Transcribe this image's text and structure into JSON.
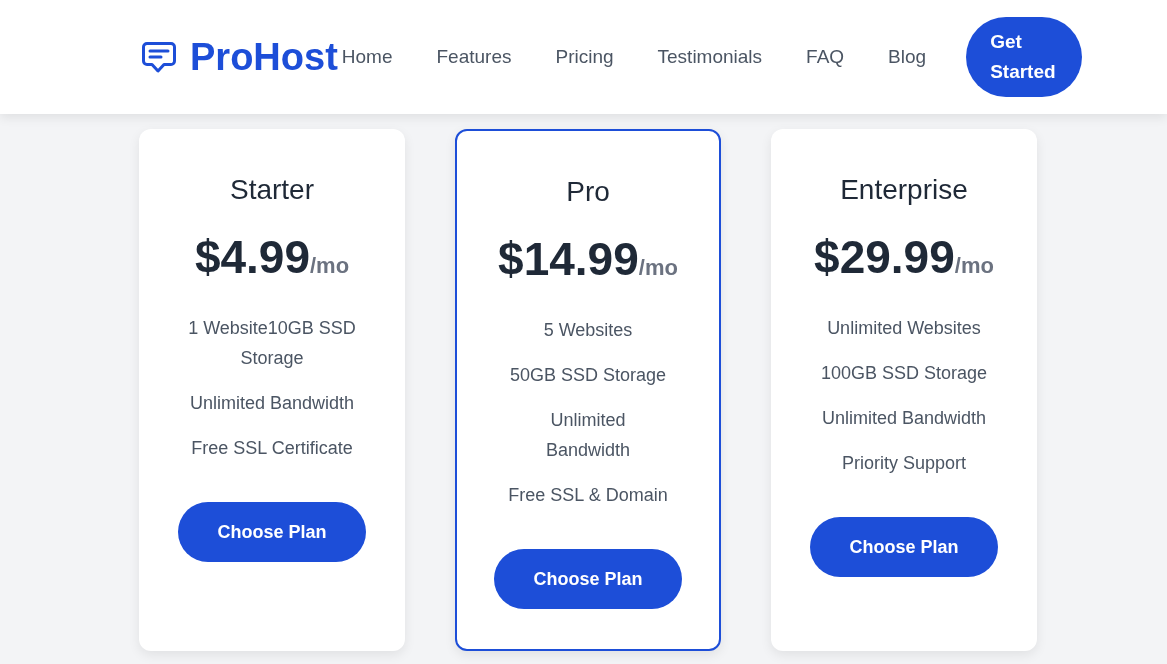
{
  "header": {
    "logo": {
      "text": "ProHost"
    },
    "nav": [
      {
        "label": "Home"
      },
      {
        "label": "Features"
      },
      {
        "label": "Pricing"
      },
      {
        "label": "Testimonials"
      },
      {
        "label": "FAQ"
      },
      {
        "label": "Blog"
      }
    ],
    "cta": {
      "label": "Get Started"
    }
  },
  "plans": [
    {
      "name": "Starter",
      "price": "$4.99",
      "period": "/mo",
      "features": [
        "1 Website10GB SSD Storage",
        "Unlimited Bandwidth",
        "Free SSL Certificate"
      ],
      "button": "Choose Plan",
      "highlighted": false
    },
    {
      "name": "Pro",
      "price": "$14.99",
      "period": "/mo",
      "features": [
        "5 Websites",
        "50GB SSD Storage",
        "Unlimited Bandwidth",
        "Free SSL & Domain"
      ],
      "button": "Choose Plan",
      "highlighted": true
    },
    {
      "name": "Enterprise",
      "price": "$29.99",
      "period": "/mo",
      "features": [
        "Unlimited Websites",
        "100GB SSD Storage",
        "Unlimited Bandwidth",
        "Priority Support"
      ],
      "button": "Choose Plan",
      "highlighted": false
    }
  ]
}
